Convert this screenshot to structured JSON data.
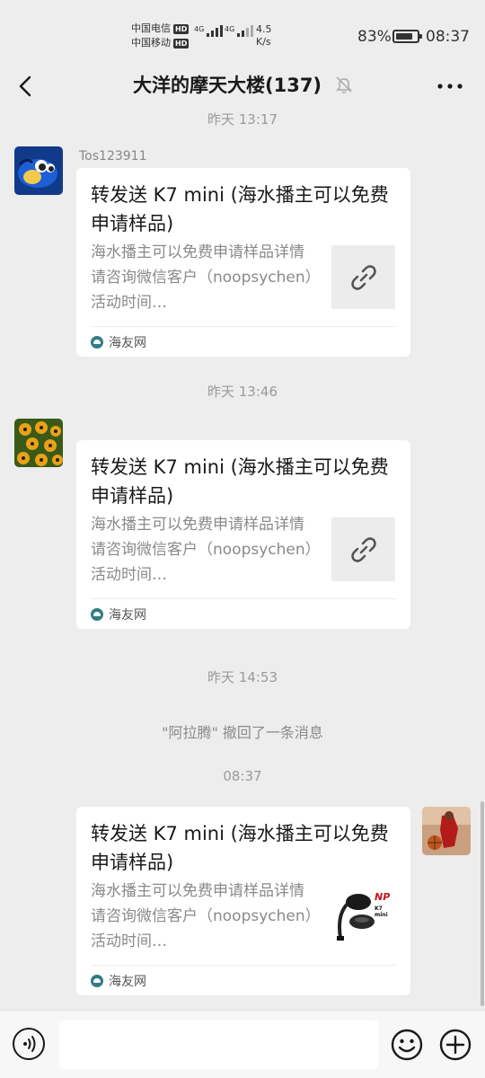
{
  "status_bar": {
    "carrier1": "中国电信",
    "carrier2": "中国移动",
    "hd_label": "HD",
    "net1": "4G",
    "net2": "4G",
    "speed_value": "4.5",
    "speed_unit": "K/s",
    "battery_pct_text": "83%",
    "battery_level": 0.83,
    "time": "08:37"
  },
  "header": {
    "title": "大洋的摩天大楼(137)",
    "back_icon": "chevron-left-icon",
    "mute_icon": "bell-off-icon",
    "more_icon": "more-dots-icon"
  },
  "messages": {
    "time_top": "昨天 13:17",
    "msg1": {
      "sender": "Tos123911",
      "title": "转发送 K7 mini (海水播主可以免费申请样品)",
      "desc": "海水播主可以免费申请样品详情请咨询微信客户（noopsychen）活动时间…",
      "source": "海友网"
    },
    "time2": "昨天 13:46",
    "msg2": {
      "title": "转发送 K7 mini (海水播主可以免费申请样品)",
      "desc": "海水播主可以免费申请样品详情请咨询微信客户（noopsychen）活动时间…",
      "source": "海友网"
    },
    "time3": "昨天 14:53",
    "recall": "\"阿拉腾\" 撤回了一条消息",
    "time4": "08:37",
    "msg3": {
      "title": "转发送 K7 mini (海水播主可以免费申请样品)",
      "desc": "海水播主可以免费申请样品详情请咨询微信客户（noopsychen）活动时间…",
      "source": "海友网",
      "thumb_brand": "NP",
      "thumb_model": "K7 mini"
    }
  },
  "input_bar": {
    "placeholder": "",
    "voice_icon": "voice-icon",
    "emoji_icon": "emoji-icon",
    "plus_icon": "plus-icon"
  },
  "colors": {
    "background": "#ededed",
    "card": "#ffffff",
    "secondary_text": "#8a8a8a"
  }
}
